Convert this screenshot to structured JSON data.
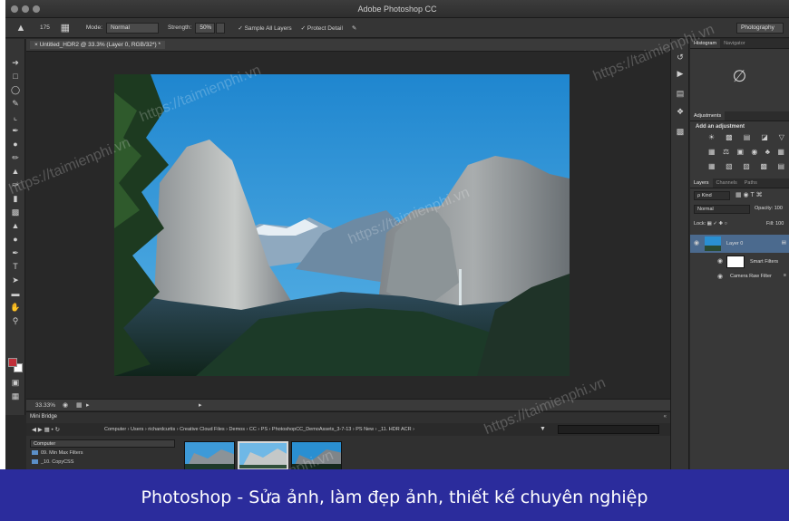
{
  "window": {
    "title": "Adobe Photoshop CC"
  },
  "options_bar": {
    "tool_size": "175",
    "mode_label": "Mode:",
    "mode_value": "Normal",
    "strength_label": "Strength:",
    "strength_value": "50%",
    "sample_all_layers": "Sample All Layers",
    "protect_detail": "Protect Detail",
    "workspace": "Photography"
  },
  "document": {
    "tab_title": "Untitled_HDR2 @ 33.3% (Layer 0, RGB/32*) *",
    "zoom": "33.33%"
  },
  "mini_bridge": {
    "title": "Mini Bridge",
    "close": "«",
    "breadcrumbs": "Computer  ›  Users  ›  richardcurtis  ›  Creative Cloud Files  ›  Demos  ›  CC  ›  PS  ›  PhotoshopCC_DemoAssets_3-7-13  ›  PS New  ›  _11. HDR ACR  ›",
    "source": "Computer",
    "folders": [
      "09. Min Max Filters",
      "_10. CopyCSS"
    ]
  },
  "panels": {
    "histogram_tabs": [
      "Histogram",
      "Navigator"
    ],
    "histogram_symbol": "∅",
    "adjustments_tab": "Adjustments",
    "adjustments_title": "Add an adjustment",
    "layers_tabs": [
      "Layers",
      "Channels",
      "Paths"
    ],
    "kind_filter": "ρ Kind",
    "blend_mode": "Normal",
    "opacity_label": "Opacity:",
    "opacity_value": "100",
    "lock_label": "Lock:",
    "fill_label": "Fill:",
    "fill_value": "100",
    "layers": [
      {
        "name": "Layer 0"
      },
      {
        "name": "Smart Filters"
      },
      {
        "name": "Camera Raw Filter"
      }
    ]
  },
  "caption": "Photoshop - Sửa ảnh, làm đẹp ảnh, thiết kế chuyên nghiệp",
  "watermark": "https://taimienphi.vn",
  "colors": {
    "app_bg": "#282828",
    "panel_bg": "#383838",
    "caption_bg": "#2b2c9c",
    "foreground_swatch": "#c0303a",
    "background_swatch": "#ffffff",
    "sky": "#2a8fd1"
  }
}
